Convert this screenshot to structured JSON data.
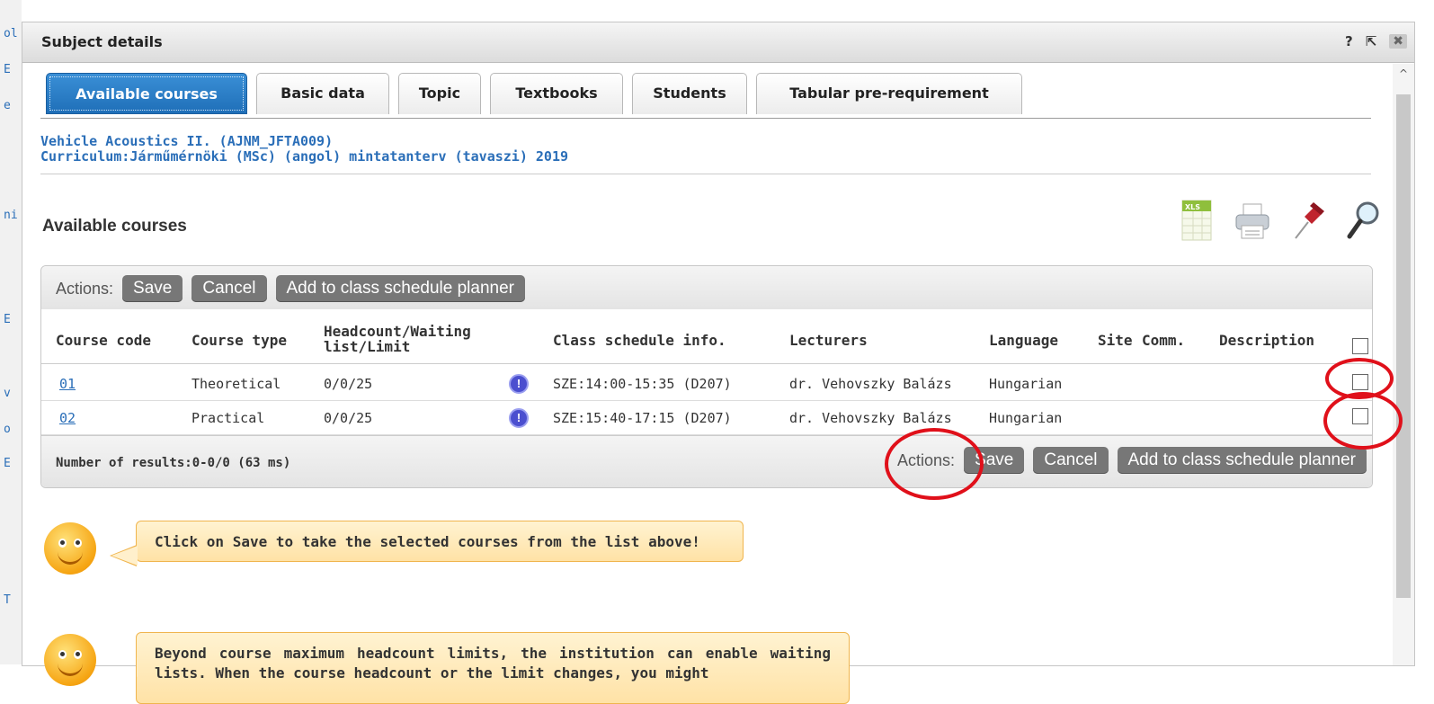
{
  "background": {
    "left_links": [
      "ol",
      "E",
      "e",
      "ni",
      "E",
      "v",
      "o",
      "E",
      "T"
    ]
  },
  "dialog": {
    "title": "Subject details",
    "help_icon": "?",
    "popout_icon": "⇱",
    "close_icon": "✖"
  },
  "tabs": [
    {
      "label": "Available courses",
      "active": true
    },
    {
      "label": "Basic data",
      "active": false
    },
    {
      "label": "Topic",
      "active": false
    },
    {
      "label": "Textbooks",
      "active": false
    },
    {
      "label": "Students",
      "active": false
    },
    {
      "label": "Tabular pre-requirement",
      "active": false
    }
  ],
  "subject": {
    "name": "Vehicle Acoustics II. (AJNM_JFTA009)",
    "curriculum": "Curriculum:Járműmérnöki (MSc) (angol) mintatanterv (tavaszi) 2019"
  },
  "section": {
    "title": "Available courses",
    "tool_icons": [
      "xls-export-icon",
      "print-icon",
      "pin-icon",
      "search-icon"
    ],
    "xls_label": "XLS"
  },
  "grid": {
    "actions_label": "Actions:",
    "actions_label_bottom": "Actions:",
    "save_label": "Save",
    "cancel_label": "Cancel",
    "planner_label": "Add to class schedule planner",
    "columns": {
      "course_code": "Course code",
      "course_type": "Course type",
      "headcount": "Headcount/Waiting list/Limit",
      "schedule": "Class schedule info.",
      "lecturers": "Lecturers",
      "language": "Language",
      "site": "Site",
      "comm": "Comm.",
      "description": "Description"
    },
    "rows": [
      {
        "code": "01",
        "type": "Theoretical",
        "headcount": "0/0/25",
        "schedule": "SZE:14:00-15:35 (D207)",
        "lecturer": "dr. Vehovszky Balázs",
        "language": "Hungarian"
      },
      {
        "code": "02",
        "type": "Practical",
        "headcount": "0/0/25",
        "schedule": "SZE:15:40-17:15 (D207)",
        "lecturer": "dr. Vehovszky Balázs",
        "language": "Hungarian"
      }
    ],
    "results": "Number of results:0-0/0 (63 ms)",
    "info_glyph": "!"
  },
  "hints": [
    "Click on Save to take the selected courses from the list above!",
    "Beyond course maximum headcount limits, the institution can enable waiting lists. When the course headcount or the limit changes, you might"
  ],
  "colors": {
    "accent_tab": "#1f6fb8",
    "link": "#2a6eb8",
    "annotation_red": "#e0101a",
    "button_gray": "#777777"
  }
}
